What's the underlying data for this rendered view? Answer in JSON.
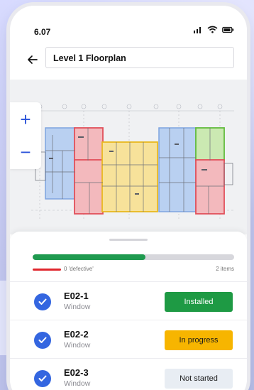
{
  "status_bar": {
    "time": "6.07",
    "icons": [
      "signal-icon",
      "wifi-icon",
      "battery-icon"
    ]
  },
  "header": {
    "title": "Level 1 Floorplan",
    "back_icon": "arrow-left-icon"
  },
  "zoom": {
    "in_label": "+",
    "out_label": "−"
  },
  "progress": {
    "fraction": 0.56,
    "defective_text": "0 'defective'",
    "items_text": "2 items"
  },
  "items": [
    {
      "code": "E02-1",
      "type": "Window",
      "status": "Installed",
      "status_color": "#1e9a44",
      "status_text_color": "#ffffff"
    },
    {
      "code": "E02-2",
      "type": "Window",
      "status": "In progress",
      "status_color": "#f7b500",
      "status_text_color": "#1a1a1a"
    },
    {
      "code": "E02-3",
      "type": "Window",
      "status": "Not started",
      "status_color": "#e8edf3",
      "status_text_color": "#1a1a1a"
    }
  ],
  "colors": {
    "accent": "#2a52d9",
    "zone_blue": "#8fb4e8",
    "zone_red": "#e8606a",
    "zone_yellow": "#f2cd3c",
    "zone_green": "#6fc44a"
  }
}
